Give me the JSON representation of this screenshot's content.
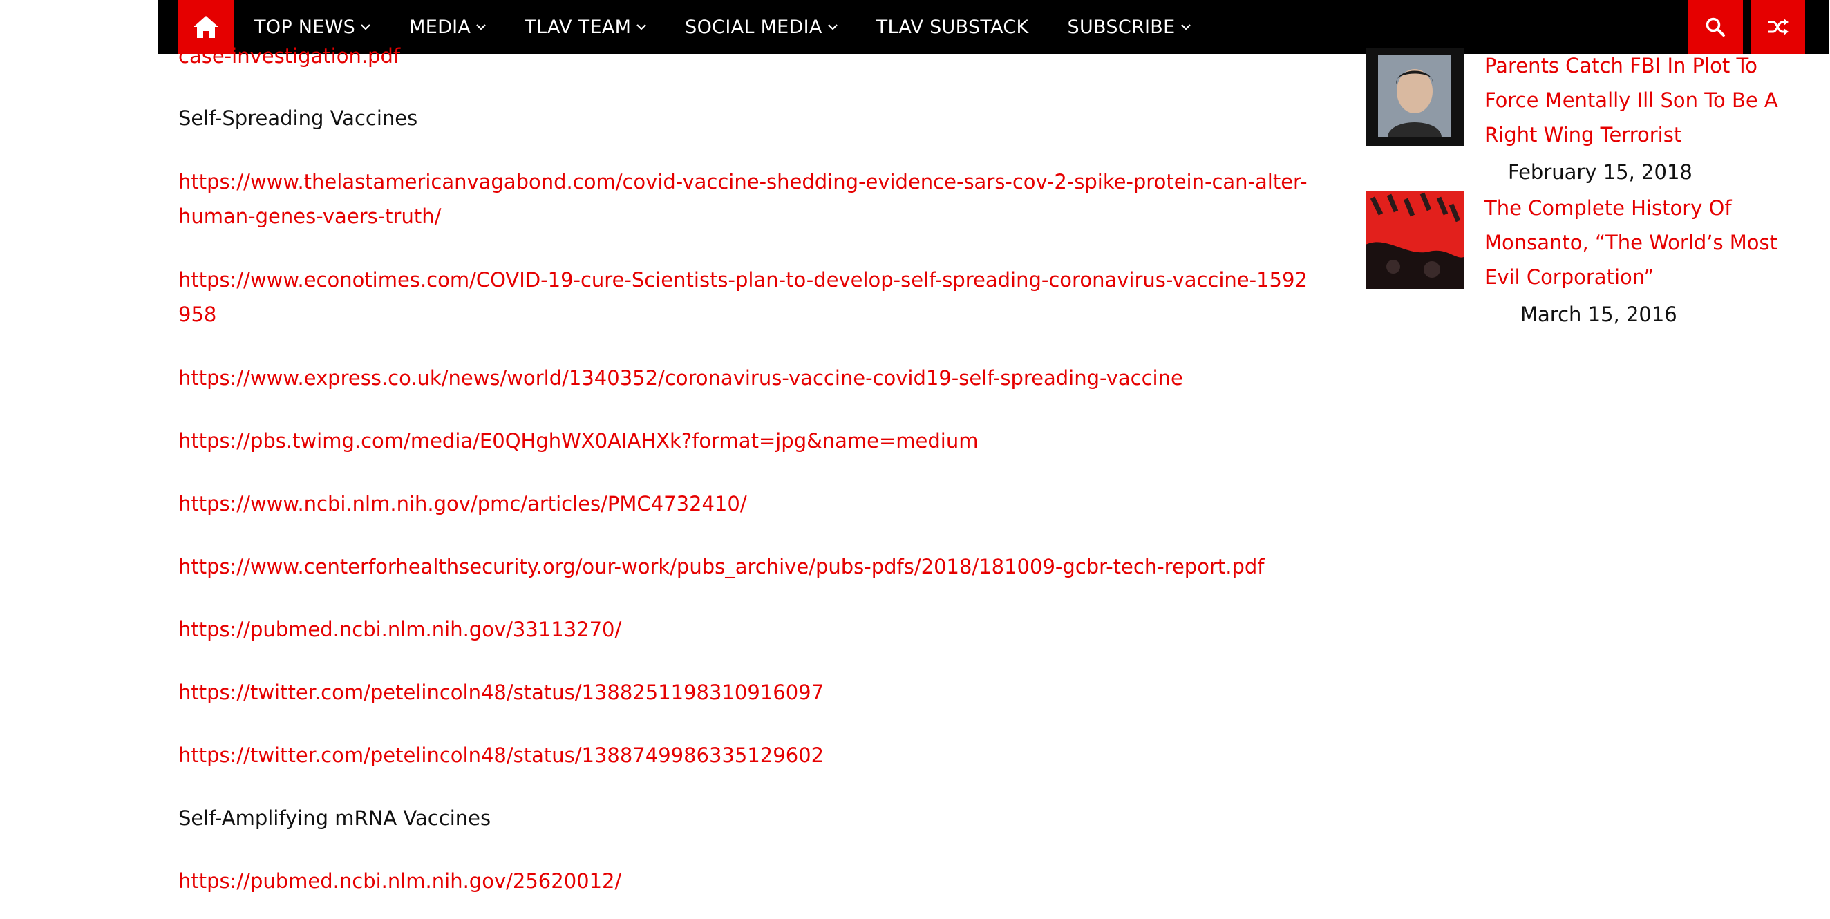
{
  "nav": {
    "items": [
      {
        "label": "TOP NEWS",
        "dropdown": true
      },
      {
        "label": "MEDIA",
        "dropdown": true
      },
      {
        "label": "TLAV TEAM",
        "dropdown": true
      },
      {
        "label": "SOCIAL MEDIA",
        "dropdown": true
      },
      {
        "label": "TLAV SUBSTACK",
        "dropdown": false
      },
      {
        "label": "SUBSCRIBE",
        "dropdown": true
      }
    ],
    "icons": {
      "home": "home-icon",
      "search": "search-icon",
      "random": "shuffle-icon"
    },
    "accent_color": "#e50000",
    "bar_color": "#000000"
  },
  "article": {
    "clipped_link": "case-investigation.pdf",
    "heading_1": "Self-Spreading Vaccines",
    "links_1": [
      "https://www.thelastamericanvagabond.com/covid-vaccine-shedding-evidence-sars-cov-2-spike-protein-can-alter-human-genes-vaers-truth/",
      "https://www.econotimes.com/COVID-19-cure-Scientists-plan-to-develop-self-spreading-coronavirus-vaccine-1592958",
      "https://www.express.co.uk/news/world/1340352/coronavirus-vaccine-covid19-self-spreading-vaccine",
      "https://pbs.twimg.com/media/E0QHghWX0AIAHXk?format=jpg&name=medium",
      "https://www.ncbi.nlm.nih.gov/pmc/articles/PMC4732410/",
      "https://www.centerforhealthsecurity.org/our-work/pubs_archive/pubs-pdfs/2018/181009-gcbr-tech-report.pdf",
      "https://pubmed.ncbi.nlm.nih.gov/33113270/",
      "https://twitter.com/petelincoln48/status/1388251198310916097",
      "https://twitter.com/petelincoln48/status/1388749986335129602"
    ],
    "heading_2": "Self-Amplifying mRNA Vaccines",
    "links_2": [
      "https://pubmed.ncbi.nlm.nih.gov/25620012/"
    ]
  },
  "sidebar": {
    "posts": [
      {
        "title": "Parents Catch FBI In Plot To Force Mentally Ill Son To Be A Right Wing Terrorist",
        "date": "February 15, 2018"
      },
      {
        "title": "The Complete History Of Monsanto, “The World’s Most Evil Corporation”",
        "date": "March 15, 2016"
      }
    ]
  }
}
